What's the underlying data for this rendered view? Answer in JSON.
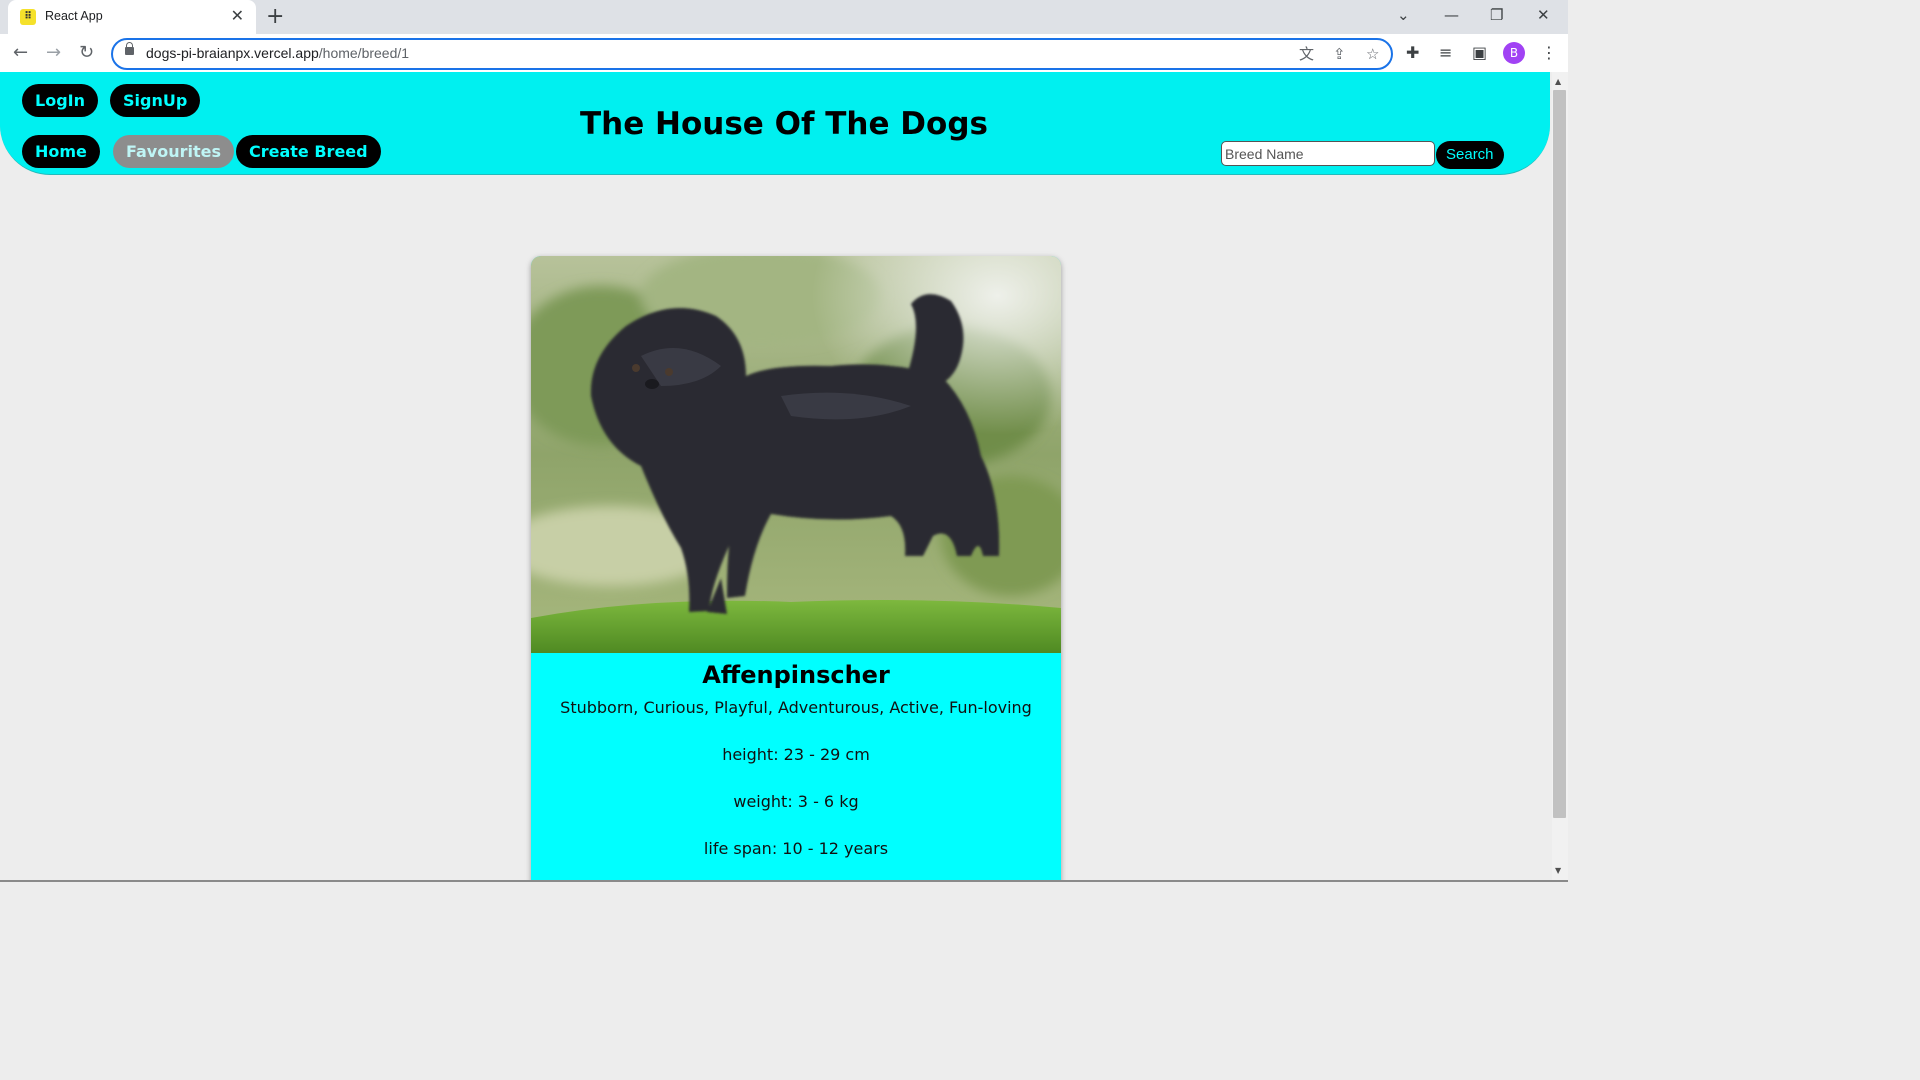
{
  "browser": {
    "tab_title": "React App",
    "tab_close": "✕",
    "new_tab": "+",
    "url_host": "dogs-pi-braianpx.vercel.app",
    "url_path": "/home/breed/1",
    "profile_initial": "B",
    "icons": [
      "back-icon",
      "forward-icon",
      "reload-icon",
      "lock-icon",
      "translate-icon",
      "share-icon",
      "star-icon",
      "extensions-icon",
      "media-icon",
      "sidepanel-icon",
      "menu-icon"
    ]
  },
  "header": {
    "login": "LogIn",
    "signup": "SignUp",
    "home": "Home",
    "favourites": "Favourites",
    "create_breed": "Create Breed",
    "title": "The House Of The Dogs",
    "search_placeholder": "Breed Name",
    "search_button": "Search"
  },
  "breed": {
    "name": "Affenpinscher",
    "temperament": "Stubborn, Curious, Playful, Adventurous, Active, Fun-loving",
    "height": "height: 23 - 29 cm",
    "weight": "weight: 3 - 6 kg",
    "life_span": "life span: 10 - 12 years"
  },
  "colors": {
    "header_bg": "#00f0f0",
    "card_bg": "#00ffff",
    "pill_bg": "#000000",
    "pill_text": "#00ffff"
  }
}
